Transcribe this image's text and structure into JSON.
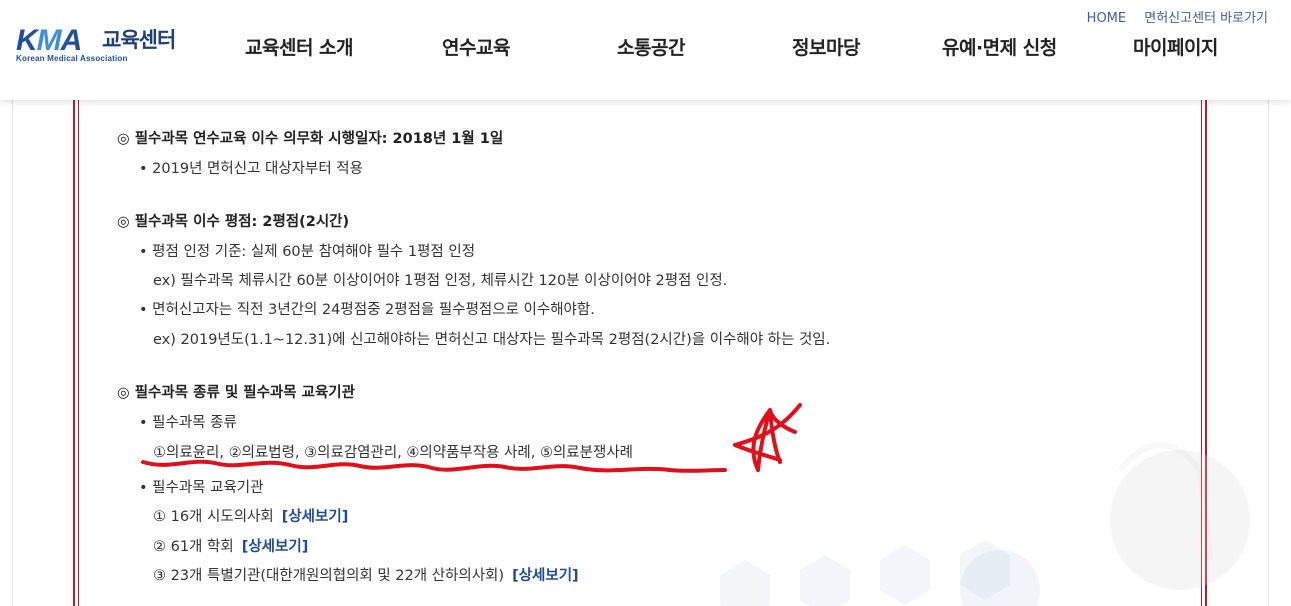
{
  "header": {
    "logo": {
      "kma_k": "K",
      "kma_m": "M",
      "kma_a": "A",
      "center": "교육센터",
      "sub": "Korean Medical Association"
    },
    "top_links": [
      "HOME",
      "면허신고센터 바로가기"
    ],
    "nav": [
      "교육센터 소개",
      "연수교육",
      "소통공간",
      "정보마당",
      "유예·면제 신청",
      "마이페이지"
    ]
  },
  "content": {
    "section1": {
      "title": "◎ 필수과목 연수교육 이수 의무화 시행일자: 2018년 1월 1일",
      "items": [
        "• 2019년 면허신고 대상자부터 적용"
      ]
    },
    "section2": {
      "title": "◎ 필수과목 이수 평점: 2평점(2시간)",
      "items": [
        "• 평점 인정 기준: 실제 60분 참여해야 필수 1평점 인정",
        "ex) 필수과목 체류시간 60분 이상이어야 1평점 인정, 체류시간 120분 이상이어야 2평점 인정.",
        "• 면허신고자는 직전 3년간의 24평점중 2평점을 필수평점으로 이수해야함.",
        "ex) 2019년도(1.1~12.31)에 신고해야하는 면허신고 대상자는 필수과목 2평점(2시간)을 이수해야 하는 것임."
      ]
    },
    "section3": {
      "title": "◎ 필수과목 종류 및 필수과목 교육기관",
      "subject_header": "• 필수과목 종류",
      "subjects": "①의료윤리, ②의료법령, ③의료감염관리, ④의약품부작용 사례, ⑤의료분쟁사례",
      "institution_header": "• 필수과목 교육기관",
      "institutions": [
        {
          "text": "① 16개 시도의사회",
          "link": "[상세보기]"
        },
        {
          "text": "② 61개 학회",
          "link": "[상세보기]"
        },
        {
          "text": "③ 23개 특별기관(대한개원의협의회 및 22개 산하의사회)",
          "link": "[상세보기]"
        }
      ]
    }
  },
  "colors": {
    "frame_red": "#b51e2a",
    "link_blue": "#1e4b95",
    "annotation_red": "#e0101a",
    "logo_blue": "#1f4f9e"
  }
}
